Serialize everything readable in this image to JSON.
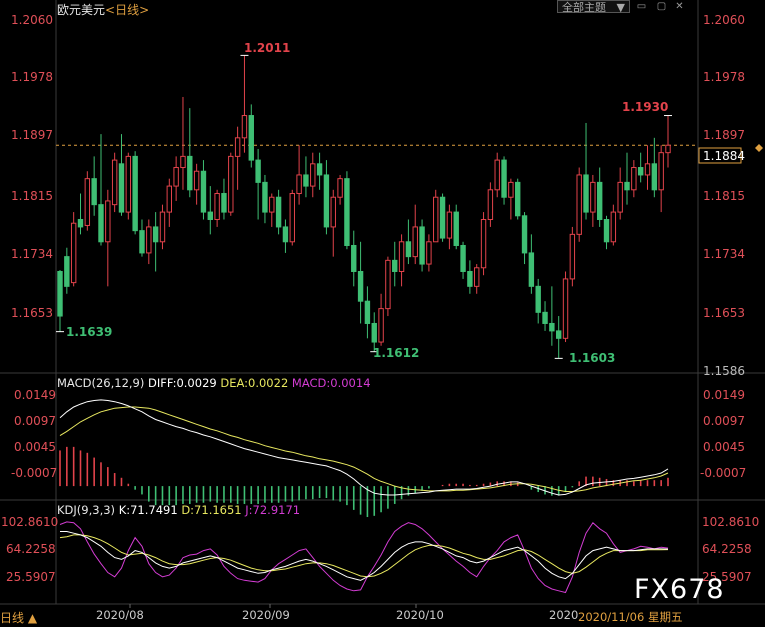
{
  "header": {
    "symbol": "欧元美元",
    "period": "<日线>",
    "theme_button": "全部主题",
    "theme_arrow": "▼"
  },
  "price_axis": {
    "ticks": [
      "1.2060",
      "1.1978",
      "1.1897",
      "1.1815",
      "1.1734",
      "1.1653"
    ],
    "bottom_label": "1.1586",
    "current_price": "1.1884"
  },
  "annotations": {
    "high1": "1.2011",
    "high2": "1.1930",
    "low1": "1.1639",
    "low2": "1.1612",
    "low3": "1.1603"
  },
  "macd": {
    "title": "MACD(26,12,9)",
    "diff_label": "DIFF:0.0029",
    "dea_label": "DEA:0.0022",
    "macd_label": "MACD:0.0014",
    "ticks": [
      "0.0149",
      "0.0097",
      "0.0045",
      "-0.0007"
    ]
  },
  "kdj": {
    "title": "KDJ(9,3,3)",
    "k_label": "K:71.7491",
    "d_label": "D:71.1651",
    "j_label": "J:72.9171",
    "ticks": [
      "102.8610",
      "64.2258",
      "25.5907"
    ]
  },
  "time_axis": {
    "labels": [
      "2020/08",
      "2020/09",
      "2020/10",
      "2020"
    ],
    "period_tab": "日线 ▲",
    "date_badge": "2020/11/06 星期五"
  },
  "watermark": "FX678",
  "colors": {
    "up": "#e2434b",
    "down": "#3fbf74",
    "diff": "#ffffff",
    "dea": "#e8e860",
    "j_line": "#d23cd2",
    "dashed": "#e0a040"
  },
  "chart_data": {
    "type": "candlestick",
    "ylim": [
      1.1586,
      1.206
    ],
    "candles": [
      {
        "o": 1.172,
        "h": 1.1722,
        "l": 1.1639,
        "c": 1.166
      },
      {
        "o": 1.174,
        "h": 1.1752,
        "l": 1.169,
        "c": 1.17
      },
      {
        "o": 1.1705,
        "h": 1.18,
        "l": 1.17,
        "c": 1.1785
      },
      {
        "o": 1.179,
        "h": 1.1825,
        "l": 1.177,
        "c": 1.178
      },
      {
        "o": 1.1782,
        "h": 1.1855,
        "l": 1.1775,
        "c": 1.1845
      },
      {
        "o": 1.1845,
        "h": 1.1875,
        "l": 1.1795,
        "c": 1.181
      },
      {
        "o": 1.181,
        "h": 1.1905,
        "l": 1.1755,
        "c": 1.176
      },
      {
        "o": 1.176,
        "h": 1.183,
        "l": 1.17,
        "c": 1.1815
      },
      {
        "o": 1.181,
        "h": 1.188,
        "l": 1.18,
        "c": 1.187
      },
      {
        "o": 1.1865,
        "h": 1.1905,
        "l": 1.1795,
        "c": 1.18
      },
      {
        "o": 1.18,
        "h": 1.188,
        "l": 1.179,
        "c": 1.1875
      },
      {
        "o": 1.1875,
        "h": 1.1882,
        "l": 1.177,
        "c": 1.1775
      },
      {
        "o": 1.1775,
        "h": 1.179,
        "l": 1.174,
        "c": 1.1745
      },
      {
        "o": 1.1745,
        "h": 1.179,
        "l": 1.173,
        "c": 1.178
      },
      {
        "o": 1.178,
        "h": 1.18,
        "l": 1.172,
        "c": 1.176
      },
      {
        "o": 1.176,
        "h": 1.181,
        "l": 1.175,
        "c": 1.18
      },
      {
        "o": 1.18,
        "h": 1.1845,
        "l": 1.178,
        "c": 1.1835
      },
      {
        "o": 1.1835,
        "h": 1.1875,
        "l": 1.1815,
        "c": 1.186
      },
      {
        "o": 1.186,
        "h": 1.1955,
        "l": 1.183,
        "c": 1.1875
      },
      {
        "o": 1.1875,
        "h": 1.194,
        "l": 1.182,
        "c": 1.183
      },
      {
        "o": 1.183,
        "h": 1.1865,
        "l": 1.181,
        "c": 1.1855
      },
      {
        "o": 1.1855,
        "h": 1.187,
        "l": 1.179,
        "c": 1.18
      },
      {
        "o": 1.18,
        "h": 1.1835,
        "l": 1.177,
        "c": 1.179
      },
      {
        "o": 1.179,
        "h": 1.183,
        "l": 1.178,
        "c": 1.1825
      },
      {
        "o": 1.1825,
        "h": 1.1845,
        "l": 1.179,
        "c": 1.18
      },
      {
        "o": 1.18,
        "h": 1.188,
        "l": 1.1795,
        "c": 1.1875
      },
      {
        "o": 1.1875,
        "h": 1.1915,
        "l": 1.183,
        "c": 1.19
      },
      {
        "o": 1.19,
        "h": 1.2011,
        "l": 1.188,
        "c": 1.193
      },
      {
        "o": 1.193,
        "h": 1.1945,
        "l": 1.186,
        "c": 1.187
      },
      {
        "o": 1.187,
        "h": 1.1885,
        "l": 1.179,
        "c": 1.184
      },
      {
        "o": 1.184,
        "h": 1.185,
        "l": 1.1785,
        "c": 1.18
      },
      {
        "o": 1.18,
        "h": 1.1825,
        "l": 1.178,
        "c": 1.182
      },
      {
        "o": 1.182,
        "h": 1.183,
        "l": 1.177,
        "c": 1.178
      },
      {
        "o": 1.178,
        "h": 1.179,
        "l": 1.1745,
        "c": 1.176
      },
      {
        "o": 1.176,
        "h": 1.183,
        "l": 1.1755,
        "c": 1.1825
      },
      {
        "o": 1.1825,
        "h": 1.189,
        "l": 1.181,
        "c": 1.185
      },
      {
        "o": 1.185,
        "h": 1.1875,
        "l": 1.182,
        "c": 1.1835
      },
      {
        "o": 1.1835,
        "h": 1.188,
        "l": 1.182,
        "c": 1.1865
      },
      {
        "o": 1.1865,
        "h": 1.188,
        "l": 1.183,
        "c": 1.185
      },
      {
        "o": 1.185,
        "h": 1.187,
        "l": 1.177,
        "c": 1.178
      },
      {
        "o": 1.178,
        "h": 1.183,
        "l": 1.174,
        "c": 1.182
      },
      {
        "o": 1.182,
        "h": 1.185,
        "l": 1.181,
        "c": 1.1845
      },
      {
        "o": 1.1845,
        "h": 1.1855,
        "l": 1.175,
        "c": 1.1755
      },
      {
        "o": 1.1755,
        "h": 1.1775,
        "l": 1.17,
        "c": 1.172
      },
      {
        "o": 1.172,
        "h": 1.176,
        "l": 1.165,
        "c": 1.168
      },
      {
        "o": 1.168,
        "h": 1.17,
        "l": 1.163,
        "c": 1.165
      },
      {
        "o": 1.165,
        "h": 1.1665,
        "l": 1.1612,
        "c": 1.1625
      },
      {
        "o": 1.1625,
        "h": 1.169,
        "l": 1.162,
        "c": 1.167
      },
      {
        "o": 1.167,
        "h": 1.174,
        "l": 1.166,
        "c": 1.1735
      },
      {
        "o": 1.1735,
        "h": 1.176,
        "l": 1.17,
        "c": 1.172
      },
      {
        "o": 1.172,
        "h": 1.177,
        "l": 1.17,
        "c": 1.176
      },
      {
        "o": 1.176,
        "h": 1.179,
        "l": 1.173,
        "c": 1.174
      },
      {
        "o": 1.174,
        "h": 1.181,
        "l": 1.173,
        "c": 1.178
      },
      {
        "o": 1.178,
        "h": 1.179,
        "l": 1.172,
        "c": 1.173
      },
      {
        "o": 1.173,
        "h": 1.177,
        "l": 1.172,
        "c": 1.176
      },
      {
        "o": 1.176,
        "h": 1.183,
        "l": 1.176,
        "c": 1.182
      },
      {
        "o": 1.182,
        "h": 1.1825,
        "l": 1.176,
        "c": 1.1765
      },
      {
        "o": 1.1765,
        "h": 1.181,
        "l": 1.175,
        "c": 1.18
      },
      {
        "o": 1.18,
        "h": 1.181,
        "l": 1.175,
        "c": 1.1755
      },
      {
        "o": 1.1755,
        "h": 1.176,
        "l": 1.171,
        "c": 1.172
      },
      {
        "o": 1.172,
        "h": 1.1735,
        "l": 1.169,
        "c": 1.17
      },
      {
        "o": 1.17,
        "h": 1.173,
        "l": 1.169,
        "c": 1.1725
      },
      {
        "o": 1.1725,
        "h": 1.18,
        "l": 1.1715,
        "c": 1.179
      },
      {
        "o": 1.179,
        "h": 1.184,
        "l": 1.178,
        "c": 1.183
      },
      {
        "o": 1.183,
        "h": 1.188,
        "l": 1.182,
        "c": 1.187
      },
      {
        "o": 1.187,
        "h": 1.1875,
        "l": 1.181,
        "c": 1.182
      },
      {
        "o": 1.182,
        "h": 1.1845,
        "l": 1.179,
        "c": 1.184
      },
      {
        "o": 1.184,
        "h": 1.1845,
        "l": 1.179,
        "c": 1.1795
      },
      {
        "o": 1.1795,
        "h": 1.18,
        "l": 1.173,
        "c": 1.1745
      },
      {
        "o": 1.1745,
        "h": 1.177,
        "l": 1.169,
        "c": 1.17
      },
      {
        "o": 1.17,
        "h": 1.171,
        "l": 1.165,
        "c": 1.1665
      },
      {
        "o": 1.1665,
        "h": 1.168,
        "l": 1.164,
        "c": 1.165
      },
      {
        "o": 1.165,
        "h": 1.17,
        "l": 1.162,
        "c": 1.164
      },
      {
        "o": 1.164,
        "h": 1.166,
        "l": 1.1603,
        "c": 1.163
      },
      {
        "o": 1.163,
        "h": 1.172,
        "l": 1.1625,
        "c": 1.171
      },
      {
        "o": 1.171,
        "h": 1.178,
        "l": 1.17,
        "c": 1.177
      },
      {
        "o": 1.177,
        "h": 1.186,
        "l": 1.176,
        "c": 1.185
      },
      {
        "o": 1.185,
        "h": 1.192,
        "l": 1.179,
        "c": 1.18
      },
      {
        "o": 1.18,
        "h": 1.185,
        "l": 1.178,
        "c": 1.184
      },
      {
        "o": 1.184,
        "h": 1.186,
        "l": 1.178,
        "c": 1.179
      },
      {
        "o": 1.179,
        "h": 1.1795,
        "l": 1.175,
        "c": 1.176
      },
      {
        "o": 1.176,
        "h": 1.181,
        "l": 1.1755,
        "c": 1.18
      },
      {
        "o": 1.18,
        "h": 1.186,
        "l": 1.179,
        "c": 1.184
      },
      {
        "o": 1.184,
        "h": 1.188,
        "l": 1.181,
        "c": 1.183
      },
      {
        "o": 1.183,
        "h": 1.187,
        "l": 1.182,
        "c": 1.186
      },
      {
        "o": 1.186,
        "h": 1.188,
        "l": 1.184,
        "c": 1.185
      },
      {
        "o": 1.185,
        "h": 1.189,
        "l": 1.183,
        "c": 1.1865
      },
      {
        "o": 1.1865,
        "h": 1.19,
        "l": 1.182,
        "c": 1.183
      },
      {
        "o": 1.183,
        "h": 1.189,
        "l": 1.18,
        "c": 1.188
      },
      {
        "o": 1.188,
        "h": 1.193,
        "l": 1.186,
        "c": 1.189
      }
    ],
    "macd": {
      "ylim": [
        -0.002,
        0.0165
      ],
      "diff": [
        0.0115,
        0.0125,
        0.0133,
        0.0138,
        0.0142,
        0.0144,
        0.0145,
        0.0144,
        0.0142,
        0.0139,
        0.0135,
        0.013,
        0.0125,
        0.0118,
        0.0112,
        0.0108,
        0.0104,
        0.01,
        0.0097,
        0.0093,
        0.009,
        0.0086,
        0.0083,
        0.0079,
        0.0075,
        0.0071,
        0.0067,
        0.0063,
        0.006,
        0.0057,
        0.0054,
        0.0051,
        0.0048,
        0.0046,
        0.0044,
        0.0042,
        0.004,
        0.0038,
        0.0036,
        0.0034,
        0.003,
        0.0026,
        0.002,
        0.0012,
        0.0002,
        -0.0006,
        -0.0012,
        -0.0014,
        -0.0015,
        -0.0015,
        -0.0014,
        -0.0013,
        -0.0012,
        -0.0011,
        -0.001,
        -0.0008,
        -0.0007,
        -0.0006,
        -0.0005,
        -0.0005,
        -0.0005,
        -0.0004,
        -0.0002,
        0.0,
        0.0003,
        0.0005,
        0.0007,
        0.0007,
        0.0004,
        0.0,
        -0.0004,
        -0.0008,
        -0.0012,
        -0.0015,
        -0.0014,
        -0.001,
        -0.0004,
        0.0002,
        0.0005,
        0.0006,
        0.0007,
        0.0008,
        0.001,
        0.0012,
        0.0013,
        0.0015,
        0.0017,
        0.0019,
        0.0022,
        0.0029
      ],
      "dea": [
        0.0085,
        0.0092,
        0.01,
        0.0108,
        0.0114,
        0.012,
        0.0125,
        0.0128,
        0.0131,
        0.0132,
        0.0133,
        0.0133,
        0.0132,
        0.0131,
        0.0128,
        0.0124,
        0.012,
        0.0116,
        0.0112,
        0.0108,
        0.0104,
        0.01,
        0.0096,
        0.0093,
        0.0089,
        0.0085,
        0.0082,
        0.0078,
        0.0075,
        0.0072,
        0.0068,
        0.0065,
        0.0062,
        0.0059,
        0.0057,
        0.0054,
        0.0051,
        0.0049,
        0.0046,
        0.0044,
        0.0042,
        0.0039,
        0.0036,
        0.0032,
        0.0026,
        0.002,
        0.0013,
        0.0008,
        0.0004,
        0.0,
        -0.0003,
        -0.0005,
        -0.0006,
        -0.0007,
        -0.0008,
        -0.0008,
        -0.0008,
        -0.0008,
        -0.0007,
        -0.0007,
        -0.0006,
        -0.0005,
        -0.0004,
        -0.0003,
        -0.0001,
        0.0001,
        0.0003,
        0.0004,
        0.0004,
        0.0003,
        0.0001,
        -0.0001,
        -0.0004,
        -0.0007,
        -0.0009,
        -0.0009,
        -0.0008,
        -0.0006,
        -0.0003,
        -0.0001,
        0.0001,
        0.0003,
        0.0005,
        0.0007,
        0.0009,
        0.001,
        0.0012,
        0.0014,
        0.0017,
        0.0022
      ],
      "hist": [
        0.006,
        0.0066,
        0.0066,
        0.006,
        0.0056,
        0.0048,
        0.004,
        0.0032,
        0.0022,
        0.0014,
        0.0004,
        -0.0006,
        -0.0014,
        -0.0026,
        -0.0032,
        -0.0032,
        -0.0032,
        -0.0032,
        -0.003,
        -0.003,
        -0.0028,
        -0.0028,
        -0.0026,
        -0.0028,
        -0.0028,
        -0.0028,
        -0.003,
        -0.003,
        -0.003,
        -0.003,
        -0.0028,
        -0.0028,
        -0.0028,
        -0.0026,
        -0.0026,
        -0.0024,
        -0.0022,
        -0.0022,
        -0.002,
        -0.002,
        -0.0024,
        -0.0026,
        -0.0032,
        -0.004,
        -0.0048,
        -0.0052,
        -0.005,
        -0.0044,
        -0.0038,
        -0.003,
        -0.0022,
        -0.0016,
        -0.0012,
        -0.0008,
        -0.0004,
        0.0,
        0.0002,
        0.0004,
        0.0004,
        0.0004,
        0.0002,
        0.0002,
        0.0004,
        0.0006,
        0.0008,
        0.0008,
        0.0008,
        0.0006,
        0.0,
        -0.0006,
        -0.001,
        -0.0014,
        -0.0016,
        -0.0016,
        -0.001,
        -0.0002,
        0.0008,
        0.0016,
        0.0016,
        0.0014,
        0.0012,
        0.001,
        0.001,
        0.001,
        0.0008,
        0.001,
        0.001,
        0.001,
        0.001,
        0.0014
      ]
    },
    "kdj": {
      "ylim": [
        10,
        112
      ],
      "k": [
        92,
        92,
        90,
        88,
        85,
        80,
        75,
        68,
        62,
        60,
        64,
        70,
        68,
        62,
        56,
        52,
        50,
        52,
        56,
        58,
        60,
        62,
        64,
        62,
        58,
        54,
        50,
        48,
        46,
        44,
        45,
        48,
        50,
        52,
        55,
        58,
        60,
        58,
        55,
        52,
        48,
        44,
        40,
        38,
        36,
        40,
        45,
        52,
        60,
        68,
        74,
        78,
        80,
        80,
        78,
        75,
        72,
        68,
        64,
        62,
        58,
        56,
        58,
        62,
        66,
        70,
        72,
        74,
        70,
        64,
        58,
        50,
        44,
        40,
        38,
        44,
        54,
        64,
        70,
        72,
        74,
        72,
        70,
        70,
        70,
        71,
        72,
        72,
        72,
        71.75
      ],
      "d": [
        85,
        86,
        88,
        88,
        87,
        85,
        82,
        78,
        73,
        68,
        65,
        66,
        67,
        65,
        62,
        58,
        55,
        54,
        54,
        55,
        57,
        59,
        61,
        62,
        61,
        59,
        56,
        53,
        50,
        48,
        47,
        47,
        48,
        49,
        51,
        53,
        55,
        56,
        56,
        55,
        53,
        50,
        47,
        44,
        41,
        40,
        41,
        44,
        48,
        54,
        60,
        66,
        71,
        74,
        76,
        76,
        75,
        73,
        70,
        67,
        65,
        62,
        60,
        60,
        62,
        64,
        67,
        70,
        71,
        69,
        65,
        60,
        55,
        50,
        46,
        44,
        46,
        51,
        57,
        63,
        67,
        70,
        70,
        70,
        70,
        70,
        71,
        71,
        71,
        71.17
      ],
      "j": [
        100,
        103,
        102,
        95,
        80,
        66,
        55,
        45,
        40,
        50,
        70,
        85,
        75,
        55,
        45,
        40,
        42,
        50,
        62,
        65,
        66,
        70,
        72,
        65,
        52,
        44,
        38,
        36,
        35,
        34,
        38,
        48,
        55,
        60,
        65,
        70,
        72,
        62,
        52,
        44,
        36,
        30,
        26,
        24,
        25,
        40,
        52,
        65,
        80,
        92,
        98,
        102,
        100,
        95,
        88,
        80,
        72,
        65,
        58,
        52,
        45,
        40,
        52,
        62,
        70,
        80,
        85,
        88,
        70,
        50,
        38,
        30,
        26,
        24,
        22,
        40,
        68,
        90,
        102,
        95,
        90,
        78,
        68,
        70,
        72,
        75,
        74,
        72,
        74,
        72.92
      ]
    }
  }
}
